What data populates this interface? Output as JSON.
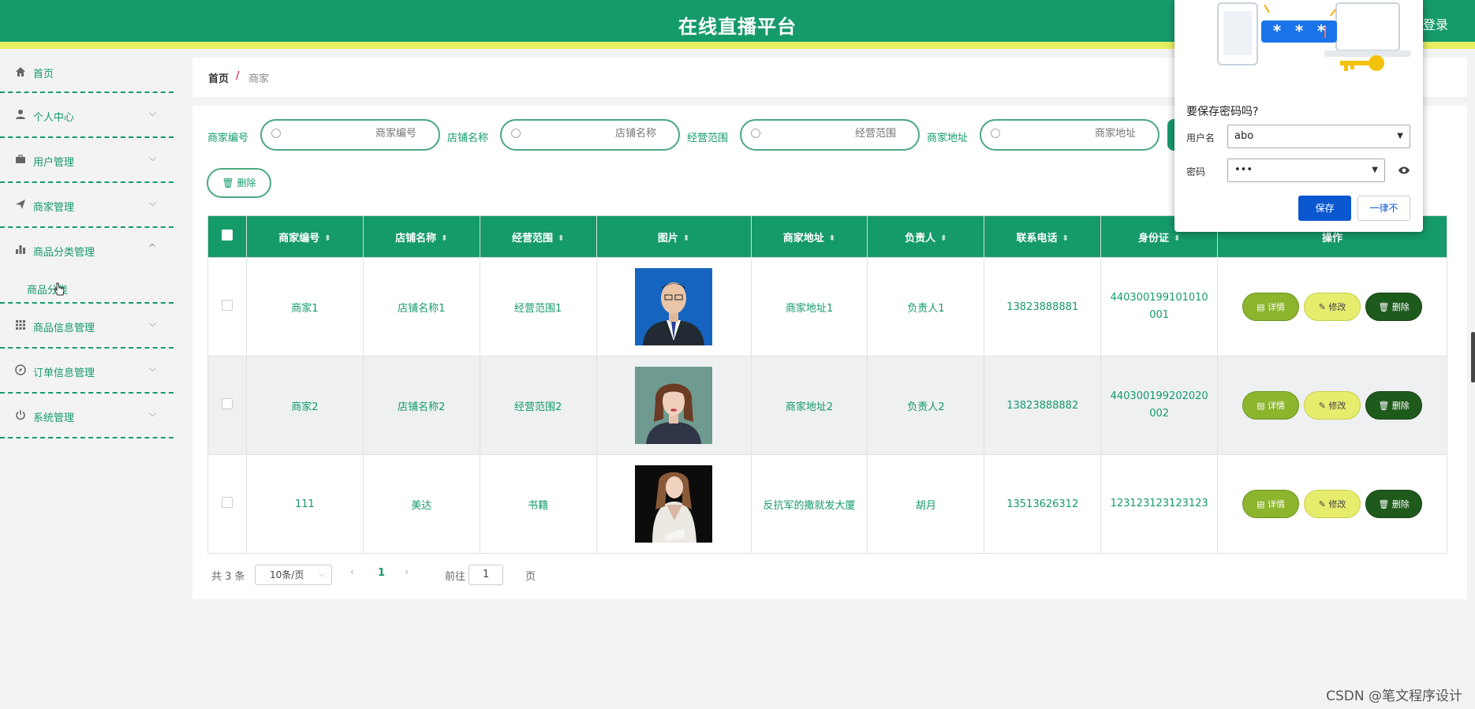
{
  "header": {
    "title": "在线直播平台",
    "login": "登录"
  },
  "sidebar": {
    "items": [
      {
        "label": "首页",
        "icon": "home-icon"
      },
      {
        "label": "个人中心",
        "icon": "user-icon"
      },
      {
        "label": "用户管理",
        "icon": "briefcase-icon"
      },
      {
        "label": "商家管理",
        "icon": "send-icon"
      },
      {
        "label": "商品分类管理",
        "icon": "bar-chart-icon",
        "expanded": true,
        "children": [
          {
            "label": "商品分类"
          }
        ]
      },
      {
        "label": "商品信息管理",
        "icon": "grid-icon"
      },
      {
        "label": "订单信息管理",
        "icon": "compass-icon"
      },
      {
        "label": "系统管理",
        "icon": "power-icon"
      }
    ]
  },
  "breadcrumb": {
    "home": "首页",
    "separator": "/",
    "current": "商家"
  },
  "search": {
    "fields": [
      {
        "label": "商家编号",
        "placeholder": "商家编号"
      },
      {
        "label": "店铺名称",
        "placeholder": "店铺名称"
      },
      {
        "label": "经营范围",
        "placeholder": "经营范围"
      },
      {
        "label": "商家地址",
        "placeholder": "商家地址"
      }
    ],
    "delete_label": "删除"
  },
  "table": {
    "columns": [
      "商家编号",
      "店铺名称",
      "经营范围",
      "图片",
      "商家地址",
      "负责人",
      "联系电话",
      "身份证",
      "操作"
    ],
    "rows": [
      {
        "id": "商家1",
        "shop": "店铺名称1",
        "scope": "经营范围1",
        "photo": "man-portrait",
        "address": "商家地址1",
        "manager": "负责人1",
        "phone": "13823888881",
        "idcard": "440300199101010001"
      },
      {
        "id": "商家2",
        "shop": "店铺名称2",
        "scope": "经营范围2",
        "photo": "woman-portrait",
        "address": "商家地址2",
        "manager": "负责人2",
        "phone": "13823888882",
        "idcard": "440300199202020002"
      },
      {
        "id": "111",
        "shop": "美达",
        "scope": "书籍",
        "photo": "woman-white-suit",
        "address": "反抗军的撒就发大厦",
        "manager": "胡月",
        "phone": "13513626312",
        "idcard": "123123123123123"
      }
    ],
    "actions": {
      "detail": "详情",
      "edit": "修改",
      "delete": "删除"
    }
  },
  "pagination": {
    "total": "共 3 条",
    "page_size": "10条/页",
    "current": "1",
    "goto_label": "前往",
    "goto_value": "1",
    "page_unit": "页"
  },
  "password_dialog": {
    "title": "要保存密码吗?",
    "username_label": "用户名",
    "username_value": "abo",
    "password_label": "密码",
    "password_value": "•••",
    "save_label": "保存",
    "never_label": "一律不",
    "mask_text": "* * *"
  },
  "watermark": "CSDN @笔文程序设计",
  "colors": {
    "primary": "#159a69",
    "accent_stripe": "#e7ee63",
    "detail": "#8cb42d",
    "edit": "#e6ec6c",
    "delete": "#1f5a1d",
    "dialog_button": "#0b57d0"
  }
}
